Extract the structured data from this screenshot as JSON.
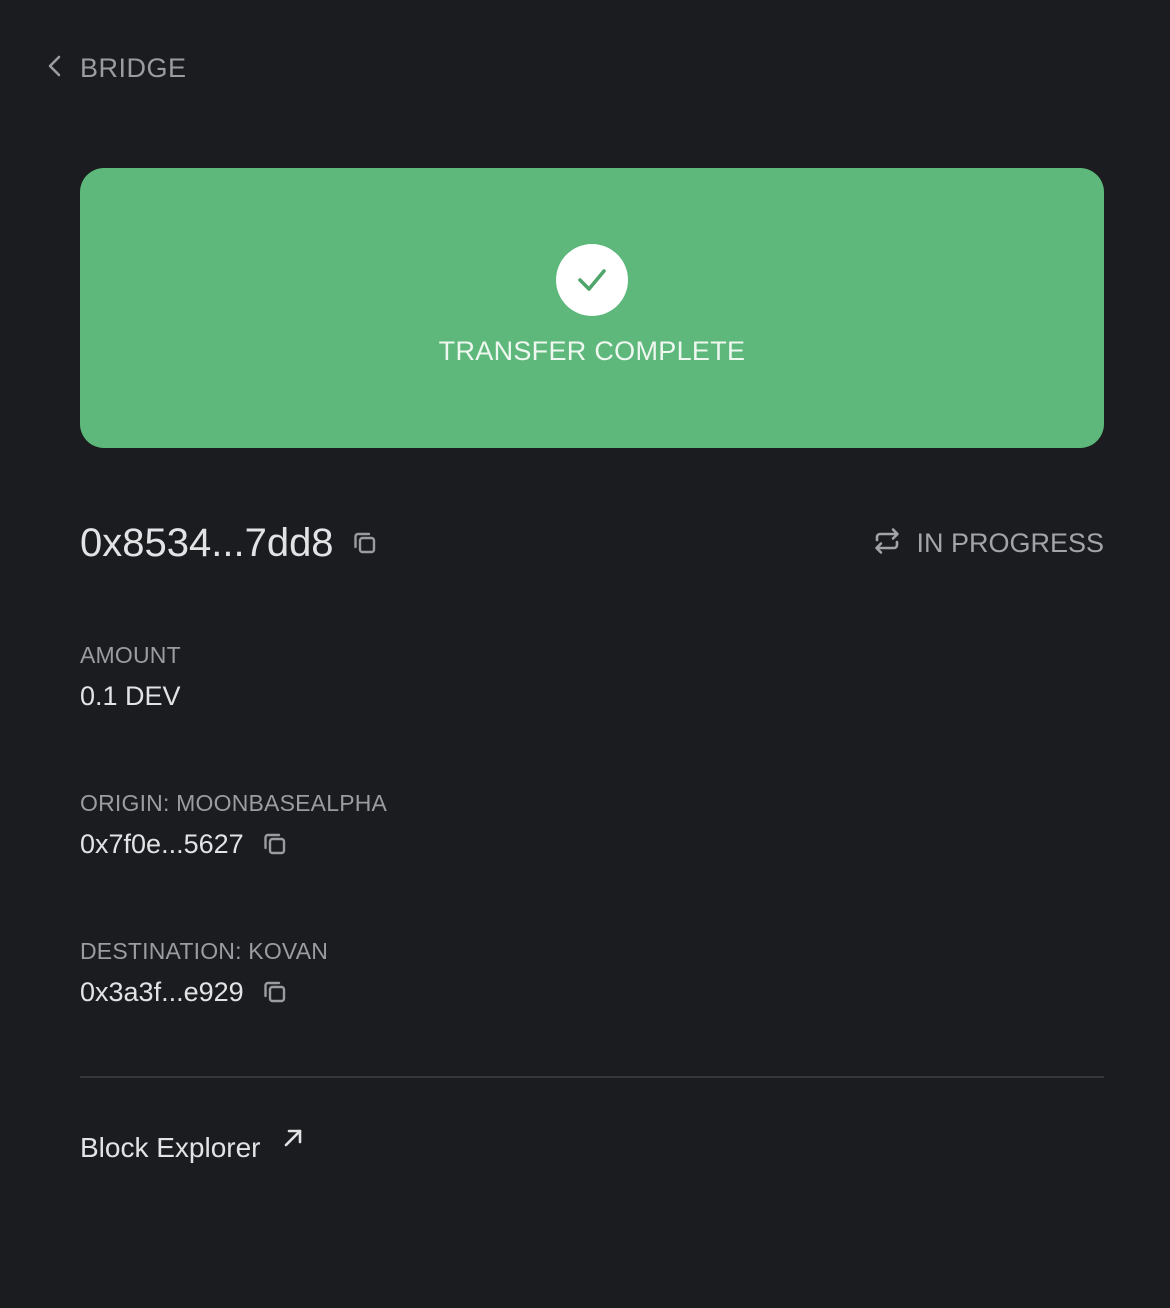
{
  "nav": {
    "back_label": "BRIDGE"
  },
  "banner": {
    "status_text": "TRANSFER COMPLETE",
    "color": "#5eb87b",
    "icon": "check-icon"
  },
  "transaction": {
    "hash": "0x8534...7dd8",
    "status": "IN PROGRESS",
    "status_icon": "repeat-icon"
  },
  "details": {
    "amount_label": "AMOUNT",
    "amount_value": "0.1 DEV",
    "origin_label": "ORIGIN: MOONBASEALPHA",
    "origin_address": "0x7f0e...5627",
    "destination_label": "DESTINATION: KOVAN",
    "destination_address": "0x3a3f...e929"
  },
  "footer": {
    "explorer_label": "Block Explorer",
    "explorer_icon": "external-link-icon"
  }
}
